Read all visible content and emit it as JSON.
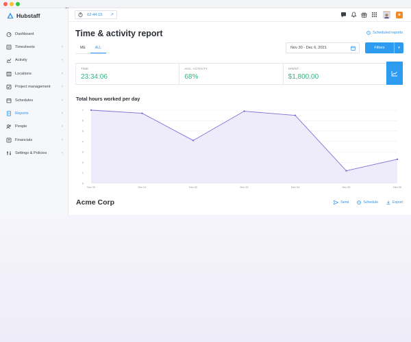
{
  "brand": {
    "name": "Hubstaff",
    "logo_icon": "hubstaff-logo-icon",
    "accent": "#2d8fea"
  },
  "sidebar": {
    "items": [
      {
        "label": "Dashboard",
        "icon": "dashboard-icon",
        "chevron": false,
        "active": false
      },
      {
        "label": "Timesheets",
        "icon": "timesheets-icon",
        "chevron": true,
        "active": false
      },
      {
        "label": "Activity",
        "icon": "activity-icon",
        "chevron": true,
        "active": false
      },
      {
        "label": "Locations",
        "icon": "locations-icon",
        "chevron": true,
        "active": false
      },
      {
        "label": "Project management",
        "icon": "project-management-icon",
        "chevron": true,
        "active": false
      },
      {
        "label": "Schedules",
        "icon": "schedules-icon",
        "chevron": true,
        "active": false
      },
      {
        "label": "Reports",
        "icon": "reports-icon",
        "chevron": true,
        "active": true
      },
      {
        "label": "People",
        "icon": "people-icon",
        "chevron": true,
        "active": false
      },
      {
        "label": "Financials",
        "icon": "financials-icon",
        "chevron": true,
        "active": false
      },
      {
        "label": "Settings & Policies",
        "icon": "settings-icon",
        "chevron": true,
        "active": false
      }
    ]
  },
  "topbar": {
    "timer": "02:44:15",
    "org_initial": "e"
  },
  "main": {
    "title": "Time & activity report",
    "scheduled_reports": "Scheduled reports",
    "tabs": [
      {
        "label": "ME",
        "active": false
      },
      {
        "label": "ALL",
        "active": true
      }
    ],
    "date_range": "Nov 30 - Dec 6, 2021",
    "filters_label": "Filters"
  },
  "stats": [
    {
      "label": "TIME",
      "value": "23:34:06"
    },
    {
      "label": "AVG. ACTIVITY",
      "value": "68%"
    },
    {
      "label": "SPENT",
      "value": "$1,800.00"
    }
  ],
  "chart_data": {
    "type": "area",
    "title": "Total hours worked per day",
    "categories": [
      "Nov 30",
      "Dec 01",
      "Dec 02",
      "Dec 03",
      "Dec 04",
      "Dec 05",
      "Dec 06"
    ],
    "values": [
      7.0,
      6.7,
      4.1,
      6.9,
      6.5,
      1.2,
      2.3
    ],
    "ylim": [
      0,
      7
    ],
    "yticks": [
      0,
      1,
      2,
      3,
      4,
      5,
      6,
      7
    ],
    "grid": true,
    "line_color": "#7b6fd6",
    "fill_color": "#ece9fb"
  },
  "section": {
    "title": "Acme Corp",
    "actions": [
      {
        "label": "Send",
        "icon": "send-icon"
      },
      {
        "label": "Schedule",
        "icon": "clock-icon"
      },
      {
        "label": "Export",
        "icon": "download-icon"
      }
    ]
  }
}
